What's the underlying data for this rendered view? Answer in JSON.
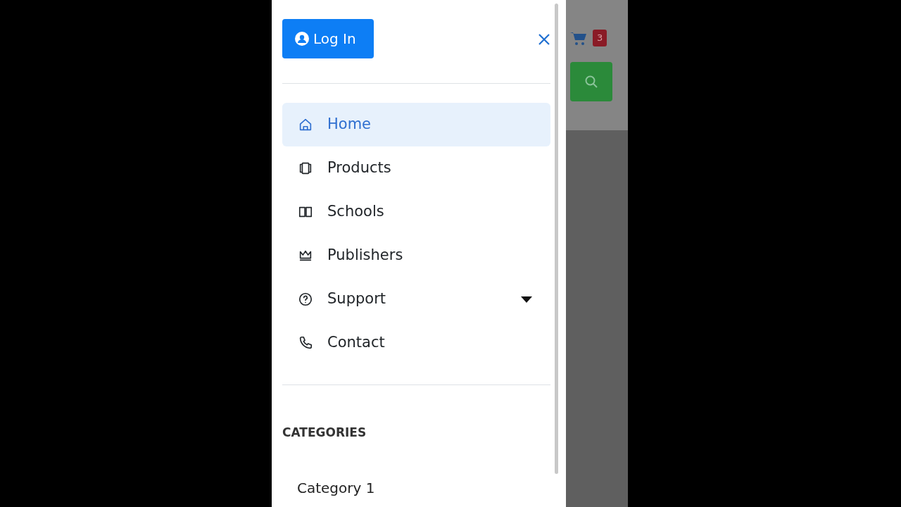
{
  "offcanvas": {
    "login_button": {
      "label": "Log In"
    },
    "nav_items": [
      {
        "label": "Home",
        "selected": true,
        "has_dropdown": false
      },
      {
        "label": "Products",
        "selected": false,
        "has_dropdown": false
      },
      {
        "label": "Schools",
        "selected": false,
        "has_dropdown": false
      },
      {
        "label": "Publishers",
        "selected": false,
        "has_dropdown": false
      },
      {
        "label": "Support",
        "selected": false,
        "has_dropdown": true
      },
      {
        "label": "Contact",
        "selected": false,
        "has_dropdown": false
      }
    ],
    "categories_heading": "CATEGORIES",
    "categories": [
      "Category 1"
    ]
  },
  "background_page": {
    "cart_count": "3"
  }
}
